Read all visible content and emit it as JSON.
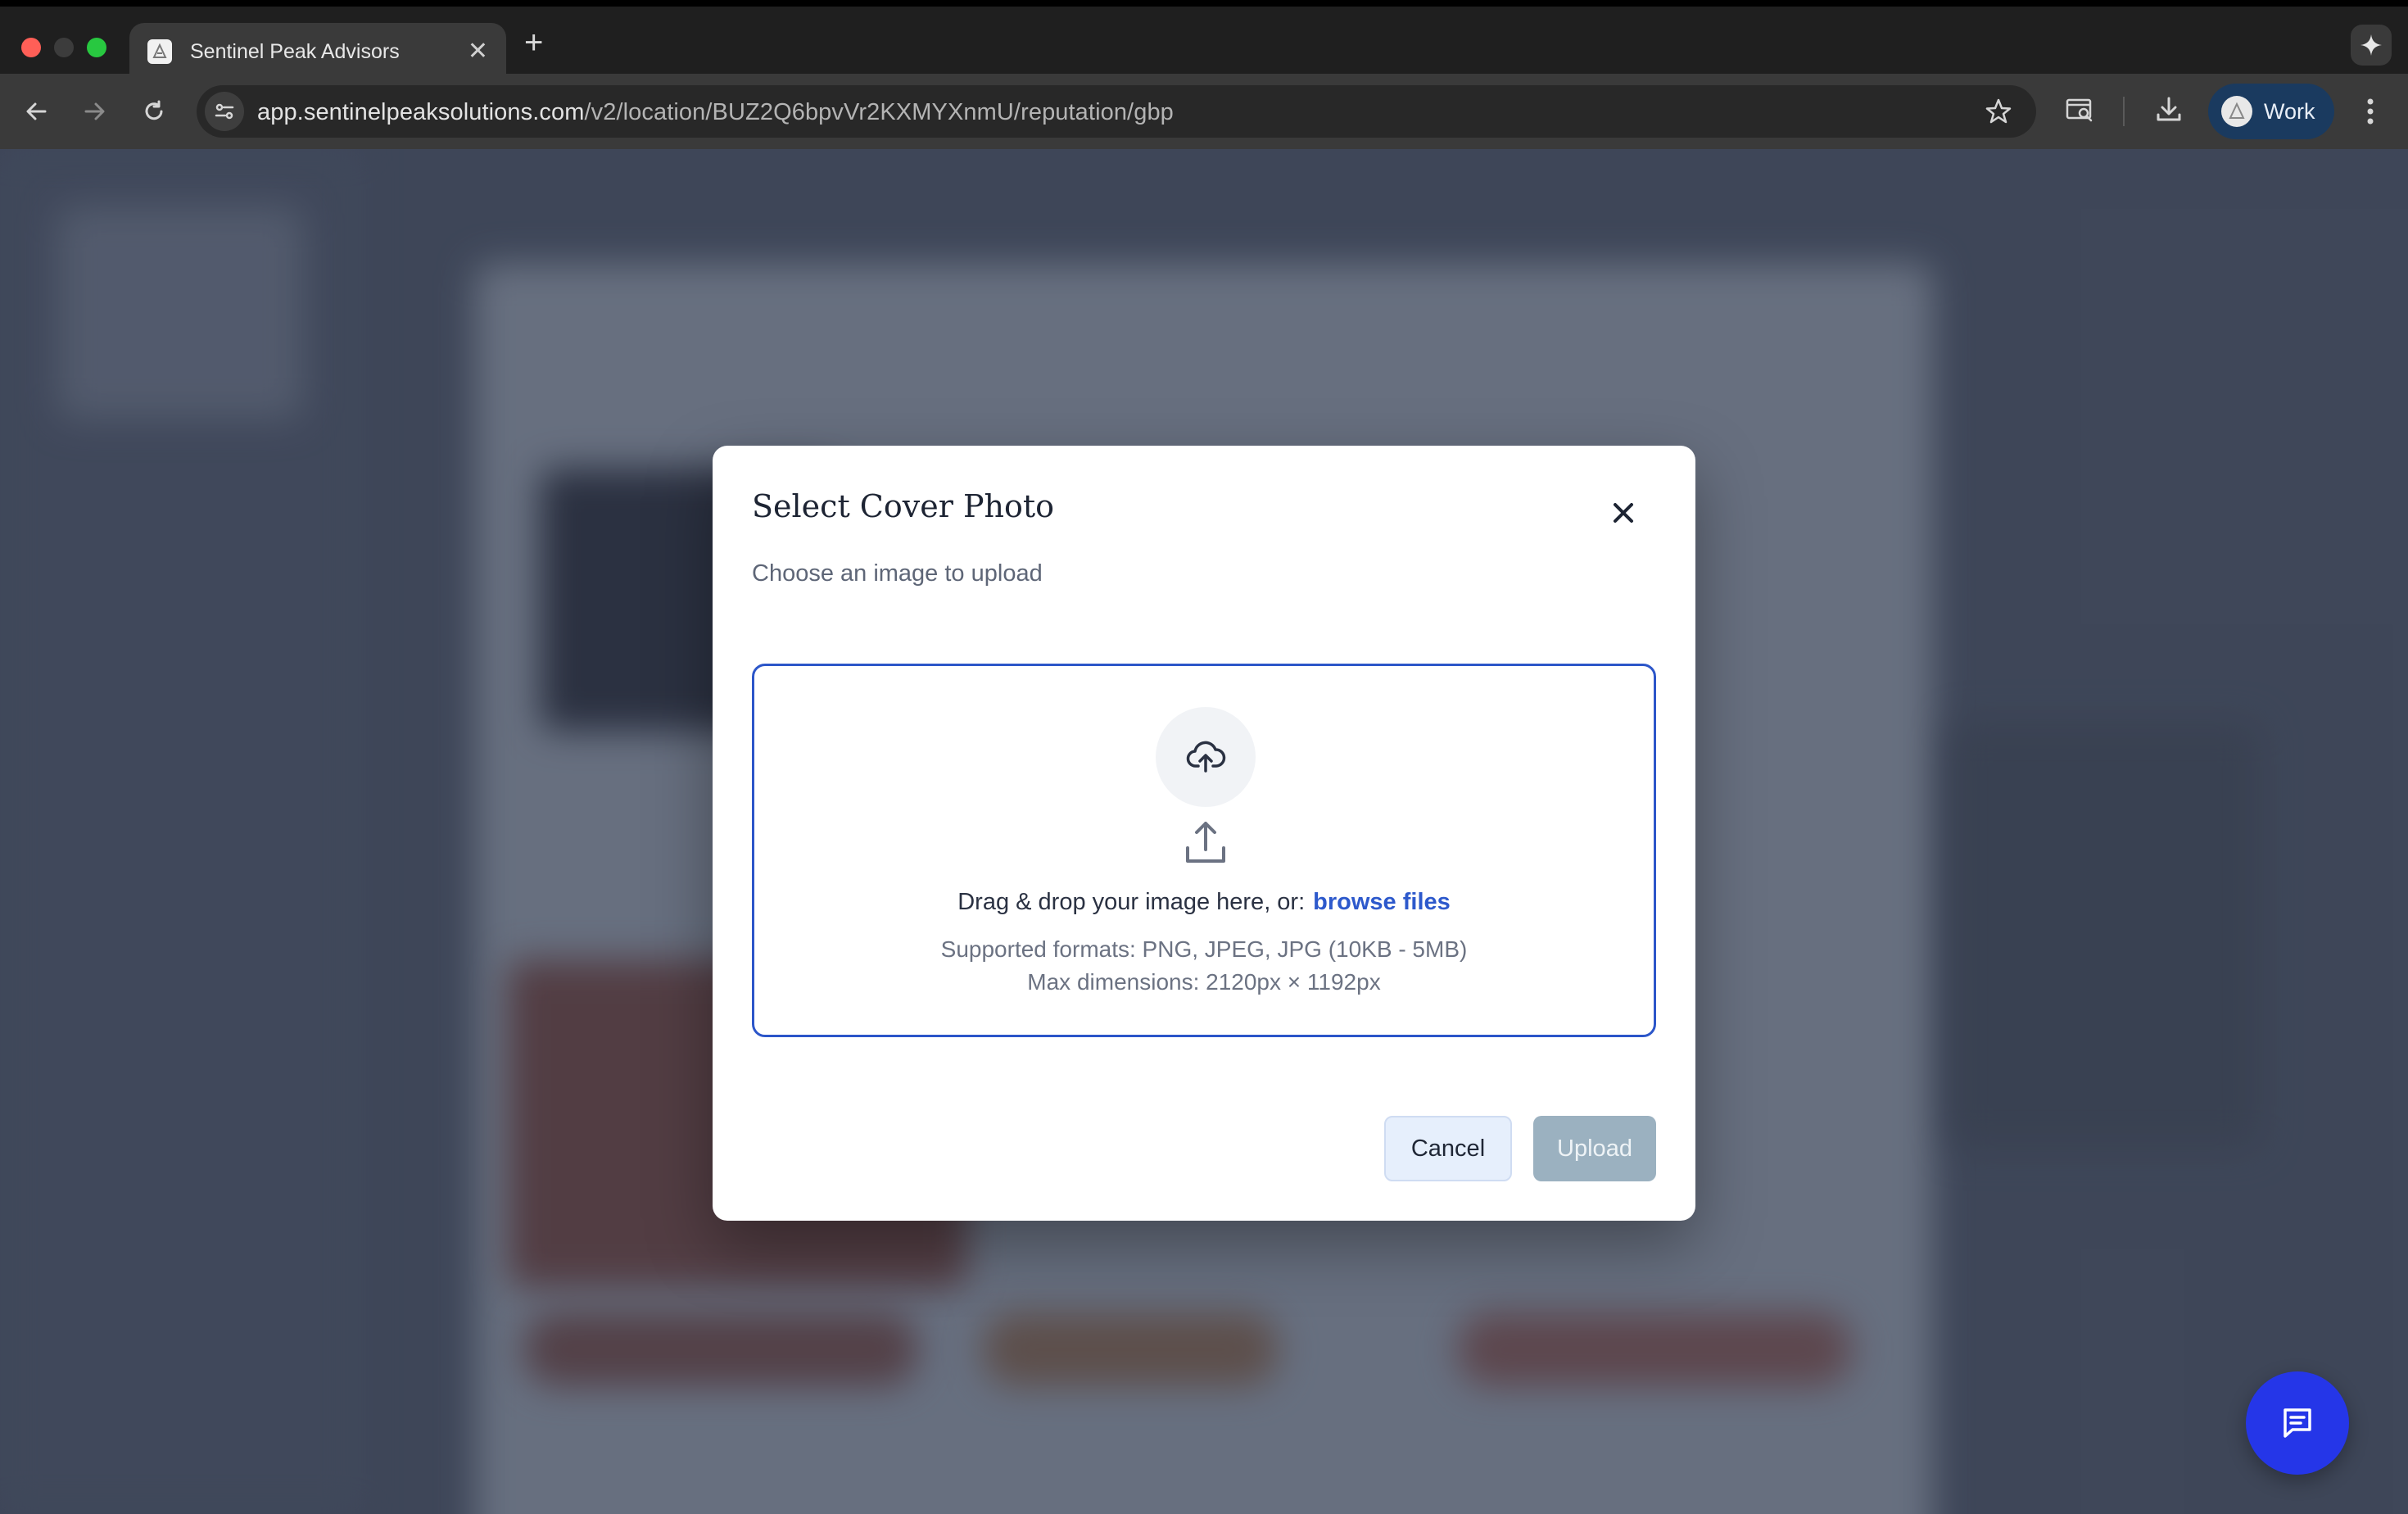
{
  "browser": {
    "tab": {
      "title": "Sentinel Peak Advisors"
    },
    "url": {
      "host": "app.sentinelpeaksolutions.com",
      "path": "/v2/location/BUZ2Q6bpvVr2KXMYXnmU/reputation/gbp"
    },
    "profile": {
      "label": "Work"
    },
    "colors": {
      "tabstrip": "#1f1f1f",
      "toolbar": "#3a3a3a",
      "profile_chip": "#1a3a5f"
    }
  },
  "modal": {
    "title": "Select Cover Photo",
    "subtitle": "Choose an image to upload",
    "dropzone": {
      "instruction": "Drag & drop your image here, or:",
      "browse_label": "browse files",
      "formats": "Supported formats: PNG, JPEG, JPG (10KB - 5MB)",
      "dimensions": "Max dimensions: 2120px × 1192px",
      "icons": [
        "cloud-upload-icon",
        "upload-tray-icon"
      ]
    },
    "buttons": {
      "cancel": "Cancel",
      "upload": "Upload"
    },
    "colors": {
      "accent": "#2c56c9",
      "upload_disabled": "#9bb1c0"
    }
  },
  "chat": {
    "icon": "chat-icon",
    "color": "#2536e8"
  }
}
